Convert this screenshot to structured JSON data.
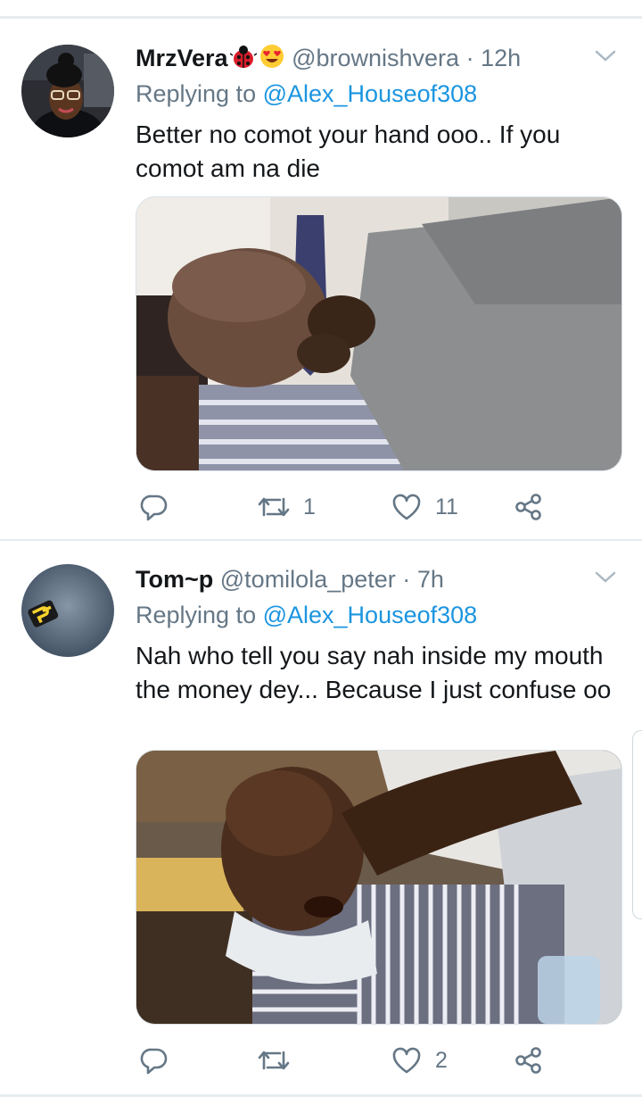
{
  "colors": {
    "accent_link": "#1b95e0",
    "secondary_text": "#657786",
    "primary_text": "#14171a",
    "divider": "#e6ecf0"
  },
  "tweets": [
    {
      "display_name": "MrzVera",
      "name_emojis": [
        "ladybug-emoji",
        "heart-eyes-emoji"
      ],
      "handle": "@brownishvera",
      "separator": "·",
      "time": "12h",
      "replying_prefix": "Replying to",
      "replying_to": "@Alex_Houseof308",
      "text": "Better no comot your hand ooo.. If you comot am na die",
      "media_icon": "photo",
      "actions": {
        "reply_icon": "reply-icon",
        "retweet_icon": "retweet-icon",
        "retweet_count": "1",
        "like_icon": "heart-icon",
        "like_count": "11",
        "share_icon": "share-icon"
      }
    },
    {
      "display_name": "Tom~p",
      "handle": "@tomilola_peter",
      "separator": "·",
      "time": "7h",
      "replying_prefix": "Replying to",
      "replying_to": "@Alex_Houseof308",
      "text": "Nah who tell you say nah inside my mouth the money dey... Because I just confuse oo",
      "avatar_logo_text": "Petert Designs",
      "media_icon": "photo",
      "actions": {
        "reply_icon": "reply-icon",
        "retweet_icon": "retweet-icon",
        "retweet_count": "",
        "like_icon": "heart-icon",
        "like_count": "2",
        "share_icon": "share-icon"
      }
    }
  ]
}
